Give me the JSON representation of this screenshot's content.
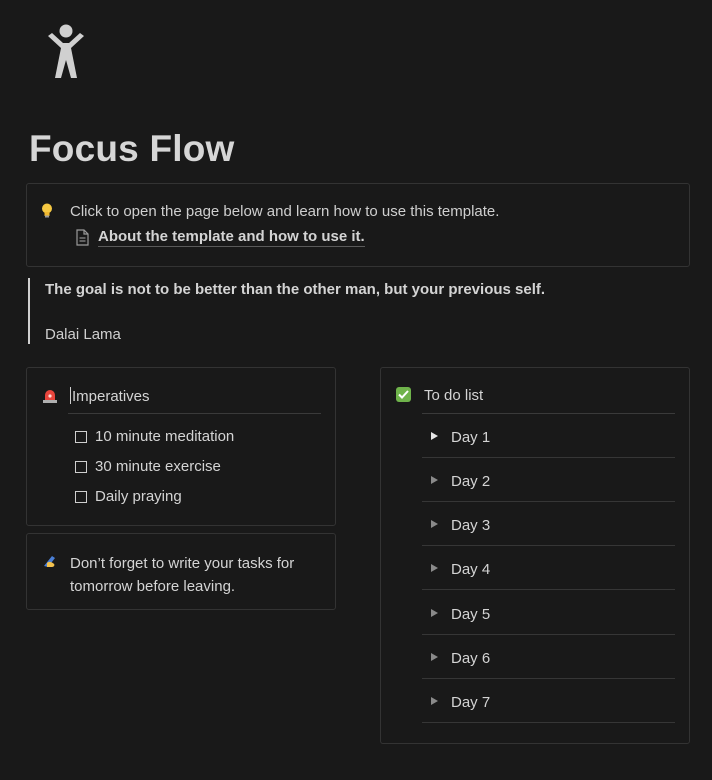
{
  "page": {
    "icon": "accessibility-person-icon",
    "title": "Focus Flow"
  },
  "intro_callout": {
    "icon": "lightbulb-icon",
    "text": "Click to open the page below and learn how to use this template.",
    "link_icon": "document-icon",
    "link_text": "About the template and how to use it."
  },
  "quote": {
    "text": "The goal is not to be better than the other man, but your previous self.",
    "author": "Dalai Lama"
  },
  "imperatives": {
    "icon": "siren-icon",
    "heading": "Imperatives",
    "items": [
      {
        "label": "10 minute meditation",
        "checked": false
      },
      {
        "label": "30 minute exercise",
        "checked": false
      },
      {
        "label": "Daily praying",
        "checked": false
      }
    ]
  },
  "reminder": {
    "icon": "writing-hand-icon",
    "line1": "Don’t forget to write your tasks for",
    "line2": "tomorrow before leaving."
  },
  "todo": {
    "icon": "green-checkmark-icon",
    "heading": "To do list",
    "days": [
      "Day 1",
      "Day 2",
      "Day 3",
      "Day 4",
      "Day 5",
      "Day 6",
      "Day 7"
    ]
  },
  "colors": {
    "background": "#191919",
    "text": "#d4d4d4",
    "border": "#333333",
    "check_green": "#6fb34b"
  }
}
